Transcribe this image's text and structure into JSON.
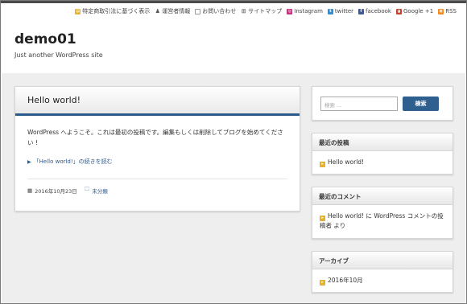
{
  "topnav": {
    "items": [
      {
        "label": "特定商取引法に基づく表示",
        "icon": "bar-icon"
      },
      {
        "label": "運営者情報",
        "icon": "user-icon"
      },
      {
        "label": "お問い合わせ",
        "icon": "mail-icon"
      },
      {
        "label": "サイトマップ",
        "icon": "sitemap-icon"
      },
      {
        "label": "Instagram",
        "icon": "instagram-icon"
      },
      {
        "label": "twitter",
        "icon": "twitter-icon"
      },
      {
        "label": "facebook",
        "icon": "facebook-icon"
      },
      {
        "label": "Google +1",
        "icon": "google-plus-icon"
      },
      {
        "label": "RSS",
        "icon": "rss-icon"
      }
    ]
  },
  "header": {
    "title": "demo01",
    "tagline": "Just another WordPress site"
  },
  "post": {
    "title": "Hello world!",
    "body": "WordPress へようこそ。これは最初の投稿です。編集もしくは削除してブログを始めてください !",
    "readmore": "「Hello world!」の続きを読む",
    "date": "2016年10月23日",
    "category": "未分類"
  },
  "sidebar": {
    "search": {
      "placeholder": "検索 ...",
      "button": "検索"
    },
    "recent_posts": {
      "title": "最近の投稿",
      "items": [
        "Hello world!"
      ]
    },
    "recent_comments": {
      "title": "最近のコメント",
      "items": [
        "Hello world! に WordPress コメントの投稿者 より"
      ]
    },
    "archives": {
      "title": "アーカイブ",
      "items": [
        "2016年10月"
      ]
    }
  },
  "colors": {
    "accent": "#2d5a8c",
    "bullet": "#e6b12d",
    "band": "#eeeeee"
  }
}
